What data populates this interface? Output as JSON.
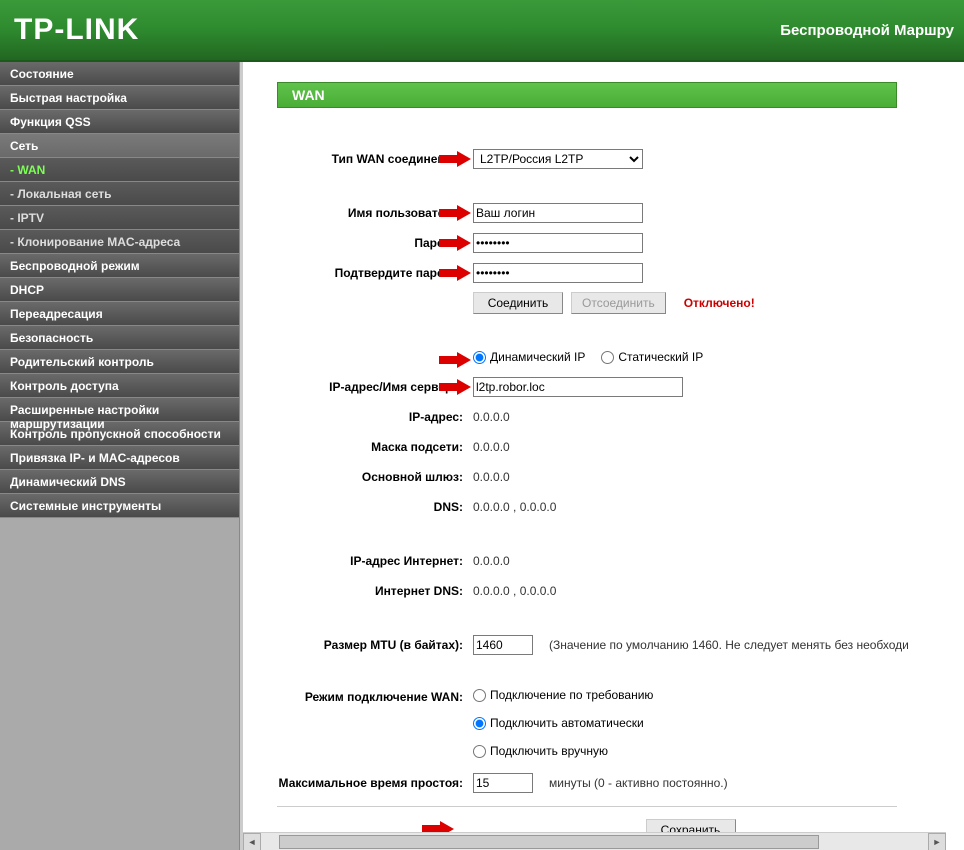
{
  "header": {
    "logo": "TP-LINK",
    "right_text": "Беспроводной Маршру"
  },
  "sidebar": {
    "items": [
      {
        "label": "Состояние",
        "type": "main"
      },
      {
        "label": "Быстрая настройка",
        "type": "main"
      },
      {
        "label": "Функция QSS",
        "type": "main"
      },
      {
        "label": "Сеть",
        "type": "main",
        "active": true
      },
      {
        "label": "- WAN",
        "type": "sub",
        "active_sub": true
      },
      {
        "label": "- Локальная сеть",
        "type": "sub"
      },
      {
        "label": "- IPTV",
        "type": "sub"
      },
      {
        "label": "- Клонирование MAC-адреса",
        "type": "sub"
      },
      {
        "label": "Беспроводной режим",
        "type": "main"
      },
      {
        "label": "DHCP",
        "type": "main"
      },
      {
        "label": "Переадресация",
        "type": "main"
      },
      {
        "label": "Безопасность",
        "type": "main"
      },
      {
        "label": "Родительский контроль",
        "type": "main"
      },
      {
        "label": "Контроль доступа",
        "type": "main"
      },
      {
        "label": "Расширенные настройки маршрутизации",
        "type": "main"
      },
      {
        "label": "Контроль пропускной способности",
        "type": "main"
      },
      {
        "label": "Привязка IP- и MAC-адресов",
        "type": "main"
      },
      {
        "label": "Динамический DNS",
        "type": "main"
      },
      {
        "label": "Системные инструменты",
        "type": "main"
      }
    ]
  },
  "page": {
    "title": "WAN",
    "wan_type_label": "Тип WAN соединения:",
    "wan_type_value": "L2TP/Россия L2TP",
    "username_label": "Имя пользователя:",
    "username_value": "Ваш логин",
    "password_label": "Пароль:",
    "password_value": "••••••••",
    "confirm_label": "Подтвердите пароль:",
    "confirm_value": "••••••••",
    "connect_btn": "Соединить",
    "disconnect_btn": "Отсоединить",
    "status_text": "Отключено!",
    "ip_mode_dynamic": "Динамический IP",
    "ip_mode_static": "Статический IP",
    "server_label": "IP-адрес/Имя сервера:",
    "server_value": "l2tp.robor.loc",
    "ip_label": "IP-адрес:",
    "ip_value": "0.0.0.0",
    "mask_label": "Маска подсети:",
    "mask_value": "0.0.0.0",
    "gateway_label": "Основной шлюз:",
    "gateway_value": "0.0.0.0",
    "dns_label": "DNS:",
    "dns_value": "0.0.0.0 , 0.0.0.0",
    "inet_ip_label": "IP-адрес Интернет:",
    "inet_ip_value": "0.0.0.0",
    "inet_dns_label": "Интернет DNS:",
    "inet_dns_value": "0.0.0.0 , 0.0.0.0",
    "mtu_label": "Размер MTU (в байтах):",
    "mtu_value": "1460",
    "mtu_hint": "(Значение по умолчанию 1460. Не следует менять без необходи",
    "conn_mode_label": "Режим подключение WAN:",
    "conn_mode_demand": "Подключение по требованию",
    "conn_mode_auto": "Подключить автоматически",
    "conn_mode_manual": "Подключить вручную",
    "idle_label": "Максимальное время простоя:",
    "idle_value": "15",
    "idle_hint": "минуты (0 - активно постоянно.)",
    "save_btn": "Сохранить"
  }
}
